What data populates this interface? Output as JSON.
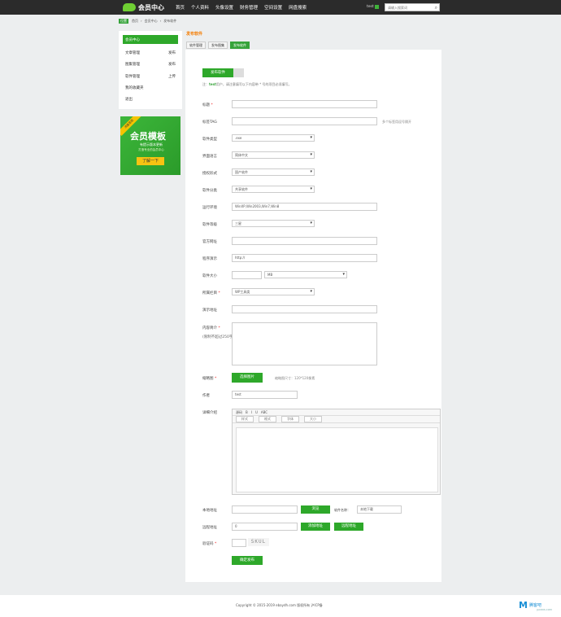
{
  "topbar": {
    "logo": "会员中心",
    "nav": [
      "首页",
      "个人资料",
      "头像设置",
      "财务管理",
      "空间设置",
      "网盘搜索"
    ],
    "user": "test",
    "search_placeholder": "请输入搜索词"
  },
  "breadcrumb": {
    "tag": "位置",
    "items": [
      "首页",
      "会员中心",
      "发布软件"
    ]
  },
  "sidebar": {
    "items": [
      {
        "label": "会员中心",
        "extra": ""
      },
      {
        "label": "文章管理",
        "extra": "发布"
      },
      {
        "label": "图集管理",
        "extra": "发布"
      },
      {
        "label": "软件管理",
        "extra": "上传"
      },
      {
        "label": "我的收藏夹",
        "extra": ""
      },
      {
        "label": "退出",
        "extra": ""
      }
    ]
  },
  "banner": {
    "ribbon": "流量变现",
    "title": "会员模板",
    "line1": "有提示版本更新",
    "line2": "打造专业的会员中心",
    "button": "了解一下"
  },
  "page": {
    "title": "发布软件"
  },
  "tabs": [
    "软件管理",
    "发布图集",
    "发布软件"
  ],
  "form": {
    "publish_button": "发布软件",
    "hint_prefix": "注：",
    "hint_user": "test",
    "hint_text": "用户，请注意填写以下内容带 * 号的项目必须填写。",
    "fields": {
      "title": "标题",
      "tags": "标签TAG",
      "tags_note": "多个标签用逗号隔开",
      "type": "软件类型",
      "type_value": ".exe",
      "lang": "界面语言",
      "lang_value": "简体中文",
      "license": "授权形式",
      "license_value": "国产软件",
      "category": "软件分类",
      "category_value": "共享软件",
      "os": "运行环境",
      "os_value": "WinXP,Win2003,Win7,Win8",
      "rank": "软件等级",
      "rank_value": "三星",
      "homepage": "官方网址",
      "demo": "程序演示",
      "demo_value": "http://",
      "size": "软件大小",
      "size_unit": "MB",
      "column": "所属栏目",
      "column_value": "WP工具类",
      "author_of_soft": "演示地址",
      "content": "内容简介",
      "content_note": "(限制不超过250字)",
      "thumb": "缩略图",
      "thumb_button": "选择图片",
      "thumb_note": "缩略图尺寸：120*120像素",
      "author": "作者",
      "author_value": "test",
      "detail": "详细介绍",
      "local": "本地地址",
      "local_button": "浏览",
      "mirror_label": "软件名称：",
      "mirror_value": "本地下载",
      "remote": "远程地址",
      "remote_value": "0",
      "remote_btn1": "添加地址",
      "remote_btn2": "远程地址",
      "captcha": "验证码",
      "captcha_text": "SKUL",
      "submit": "确定发布"
    }
  },
  "editor": {
    "toolbar1": [
      "源码",
      "B",
      "I",
      "U",
      "ABC"
    ],
    "toolbar2": [
      "样式",
      "格式",
      "字体",
      "大小"
    ]
  },
  "footer": {
    "text": "Copyright © 2015-2019 ebaydh.com 版权所有 沪ICP备"
  },
  "watermark": {
    "main": "M",
    "text": "腾客吧",
    "sub": "JAXWIS.COM"
  },
  "colors": {
    "green": "#2ea82a",
    "topbar": "#2b2b2b",
    "orange": "#f57c00"
  }
}
